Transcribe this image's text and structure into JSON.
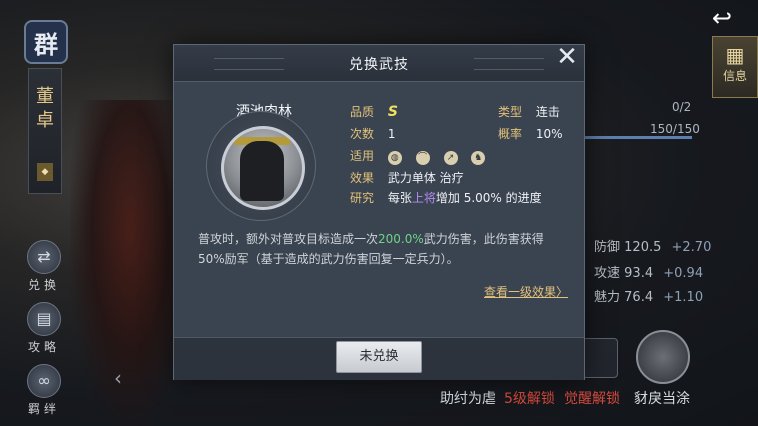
{
  "sidebar": {
    "faction": "群",
    "hero_name": "董卓",
    "buttons": [
      {
        "label": "兑换",
        "icon": "exchange-icon"
      },
      {
        "label": "攻略",
        "icon": "strategy-icon"
      },
      {
        "label": "羁绊",
        "icon": "bond-icon"
      }
    ]
  },
  "right_panel": {
    "info_label": "信息",
    "count": "0/2",
    "exp": "150/150",
    "stats": [
      {
        "name": "防御",
        "value": "120.5",
        "bonus": "+2.70"
      },
      {
        "name": "攻速",
        "value": "93.4",
        "bonus": "+0.94"
      },
      {
        "name": "魅力",
        "value": "76.4",
        "bonus": "+1.10"
      }
    ],
    "bottom_labels": [
      {
        "text": "助纣为虐",
        "color": "#d9dde3"
      },
      {
        "text": "5级解锁",
        "color": "#d74a3c"
      },
      {
        "text": "觉醒解锁",
        "color": "#d74a3c"
      },
      {
        "text": "豺戾当涂",
        "color": "#d9dde3"
      }
    ]
  },
  "dialog": {
    "title": "兑换武技",
    "skill_name": "酒池肉林",
    "attributes": {
      "quality_label": "品质",
      "quality_value": "S",
      "type_label": "类型",
      "type_value": "连击",
      "count_label": "次数",
      "count_value": "1",
      "prob_label": "概率",
      "prob_value": "10%",
      "apply_label": "适用",
      "apply_icons": [
        "shield-icon",
        "bow-icon",
        "spear-icon",
        "horse-icon"
      ],
      "effect_label": "效果",
      "effect_value": "武力单体 治疗",
      "research_label": "研究",
      "research_prefix": "每张",
      "research_highlight": "上将",
      "research_suffix": "增加 5.00% 的进度"
    },
    "description": {
      "part1": "普攻时，额外对普攻目标造成一次",
      "highlight": "200.0%",
      "part2": "武力伤害，此伤害获得50%励军（基于造成的武力伤害回复一定兵力）。"
    },
    "link": "查看一级效果",
    "button": "未兑换"
  }
}
